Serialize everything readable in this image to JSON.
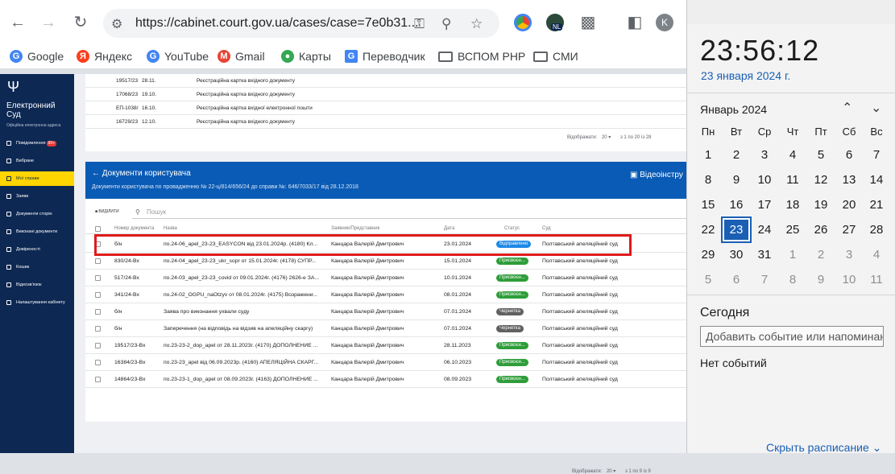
{
  "browser": {
    "url": "https://cabinet.court.gov.ua/cases/case=7e0b31...",
    "profile_initial": "K",
    "ext_badge": "NL",
    "bookmarks": [
      "Google",
      "Яндекс",
      "YouTube",
      "Gmail",
      "Карты",
      "Переводчик",
      "ВСПОМ РНР",
      "СМИ"
    ]
  },
  "sidebar": {
    "title": "Електронний Суд",
    "subtitle": "Офіційна електронна адреса",
    "items": [
      {
        "label": "Повідомлення",
        "badge": "99+"
      },
      {
        "label": "Вибране"
      },
      {
        "label": "Мої справи"
      },
      {
        "label": "Заяви"
      },
      {
        "label": "Документи сторін"
      },
      {
        "label": "Виконані документи"
      },
      {
        "label": "Довіреності"
      },
      {
        "label": "Кошик"
      },
      {
        "label": "Відеозв'язок"
      },
      {
        "label": "Налаштування кабінету"
      }
    ]
  },
  "top_panel": {
    "rows": [
      {
        "num": "19517/23",
        "date": "28.11.",
        "name": "Реєстраційна картка вхідного документу"
      },
      {
        "num": "17068/23",
        "date": "19.10.",
        "name": "Реєстраційна картка вхідного документу"
      },
      {
        "num": "ЕП-1038/",
        "date": "16.10.",
        "name": "Реєстраційна картка вхідної електронної пошти"
      },
      {
        "num": "16729/23",
        "date": "12.10.",
        "name": "Реєстраційна картка вхідного документу"
      }
    ],
    "pager_label": "Відображати:",
    "pager_count": "20",
    "pager_range": "з 1 по 20 із 28"
  },
  "docs": {
    "title": "Документи користувача",
    "subtitle": "Документи користувача по провадженню № 22-ц/814/656/24 до справи №: 646/7033/17 від 28.12.2018",
    "video": "Відеоінстру",
    "select_all": "ВИДІЛИТИ",
    "search_placeholder": "Пошук",
    "headers": {
      "num": "Номер документа",
      "name": "Назва",
      "author": "Заявник/Представник",
      "date": "Дата",
      "status": "Статус",
      "court": "Суд"
    },
    "rows": [
      {
        "num": "б/н",
        "name": "по.24-06_apel_23-23_EASYCON від 23.01.2024р. (4180) Кл...",
        "author": "Канцара Валерій Дмитрович",
        "date": "23.01.2024",
        "status": "Відправлено",
        "color": "#1e88e5",
        "court": "Полтавський апеляційний суд"
      },
      {
        "num": "830/24-Вх",
        "name": "по.24-04_apel_23-23_ukr_sopr от 15.01.2024г. (4178) СУПР...",
        "author": "Канцара Валерій Дмитрович",
        "date": "15.01.2024",
        "status": "Присвоєн...",
        "color": "#2e9d3a",
        "court": "Полтавський апеляційний суд"
      },
      {
        "num": "517/24-Вх",
        "name": "по.24-03_apel_23-23_covid от 09.01.2024г. (4176) 2626-е ЗА...",
        "author": "Канцара Валерій Дмитрович",
        "date": "10.01.2024",
        "status": "Присвоєн...",
        "color": "#2e9d3a",
        "court": "Полтавський апеляційний суд"
      },
      {
        "num": "341/24-Вх",
        "name": "по.24-02_OGPU_naOtzyv от 08.01.2024г. (4175) Возражени...",
        "author": "Канцара Валерій Дмитрович",
        "date": "08.01.2024",
        "status": "Присвоєн...",
        "color": "#2e9d3a",
        "court": "Полтавський апеляційний суд"
      },
      {
        "num": "б/н",
        "name": "Заява про виконання ухвали суду",
        "author": "Канцара Валерій Дмитрович",
        "date": "07.01.2024",
        "status": "Чернетка",
        "color": "#616161",
        "court": "Полтавський апеляційний суд"
      },
      {
        "num": "б/н",
        "name": "Заперечення (на відповідь на відзив на апеляційну скаргу)",
        "author": "Канцара Валерій Дмитрович",
        "date": "07.01.2024",
        "status": "Чернетка",
        "color": "#616161",
        "court": "Полтавський апеляційний суд"
      },
      {
        "num": "19517/23-Вх",
        "name": "по.23-23-2_dop_apel от 28.11.2023г. (4170) ДОПОЛНЕНИЕ ...",
        "author": "Канцара Валерій Дмитрович",
        "date": "28.11.2023",
        "status": "Присвоєн...",
        "color": "#2e9d3a",
        "court": "Полтавський апеляційний суд"
      },
      {
        "num": "16384/23-Вх",
        "name": "по.23-23_apel від 06.09.2023р. (4160) АПЕЛЯЦІЙНА СКАРГ...",
        "author": "Канцара Валерій Дмитрович",
        "date": "06.10.2023",
        "status": "Присвоєн...",
        "color": "#2e9d3a",
        "court": "Полтавський апеляційний суд"
      },
      {
        "num": "14864/23-Вх",
        "name": "по.23-23-1_dop_apel от 08.09.2023г. (4163) ДОПОЛНЕНИЕ ...",
        "author": "Канцара Валерій Дмитрович",
        "date": "08.09.2023",
        "status": "Присвоєн...",
        "color": "#2e9d3a",
        "court": "Полтавський апеляційний суд"
      }
    ],
    "pager_label": "Відображати:",
    "pager_count": "20",
    "pager_range": "з 1 по 9 із 9"
  },
  "clock": {
    "time": "23:56:12",
    "date": "23 января 2024 г.",
    "month": "Январь 2024",
    "weekdays": [
      "Пн",
      "Вт",
      "Ср",
      "Чт",
      "Пт",
      "Сб",
      "Вс"
    ],
    "weeks": [
      [
        "1",
        "2",
        "3",
        "4",
        "5",
        "6",
        "7"
      ],
      [
        "8",
        "9",
        "10",
        "11",
        "12",
        "13",
        "14"
      ],
      [
        "15",
        "16",
        "17",
        "18",
        "19",
        "20",
        "21"
      ],
      [
        "22",
        "23",
        "24",
        "25",
        "26",
        "27",
        "28"
      ],
      [
        "29",
        "30",
        "31",
        "1",
        "2",
        "3",
        "4"
      ],
      [
        "5",
        "6",
        "7",
        "8",
        "9",
        "10",
        "11"
      ]
    ],
    "today": "23",
    "today_label": "Сегодня",
    "add_event_placeholder": "Добавить событие или напоминание",
    "no_events": "Нет событий",
    "schedule_link": "Скрыть расписание"
  }
}
